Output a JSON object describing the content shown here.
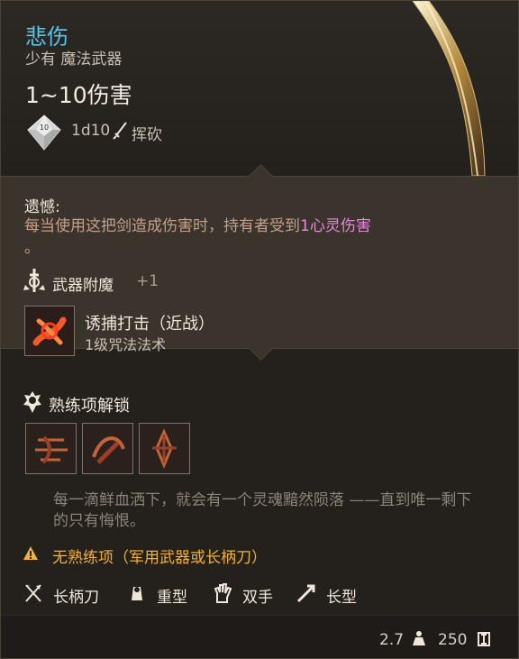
{
  "item": {
    "name": "悲伤",
    "rarity": "少有",
    "type": "魔法武器",
    "damage": "1~10伤害",
    "dice": "1d10",
    "attack_type": "挥砍"
  },
  "regret": {
    "title": "遗憾:",
    "text_before": "每当使用这把剑造成伤害时，持有者受到",
    "highlight": "1心灵伤害",
    "text_after": "。"
  },
  "enchant": {
    "label": "武器附魔",
    "bonus": "+1"
  },
  "spell": {
    "name": "诱捕打击（近战）",
    "level": "1级咒法法术"
  },
  "proficiency": {
    "title": "熟练项解锁"
  },
  "flavor": "每一滴鲜血洒下，就会有一个灵魂黯然陨落 ——直到唯一剩下的只有悔恨。",
  "warning": "无熟练项（军用武器或长柄刀）",
  "properties": [
    {
      "icon": "halberd-icon",
      "label": "长柄刀"
    },
    {
      "icon": "heavy-icon",
      "label": "重型"
    },
    {
      "icon": "two-handed-icon",
      "label": "双手"
    },
    {
      "icon": "reach-icon",
      "label": "长型"
    }
  ],
  "footer": {
    "weight": "2.7",
    "value": "250"
  },
  "colors": {
    "title": "#52c6ee",
    "psychic": "#e38ad9",
    "warning": "#f0b13c"
  }
}
